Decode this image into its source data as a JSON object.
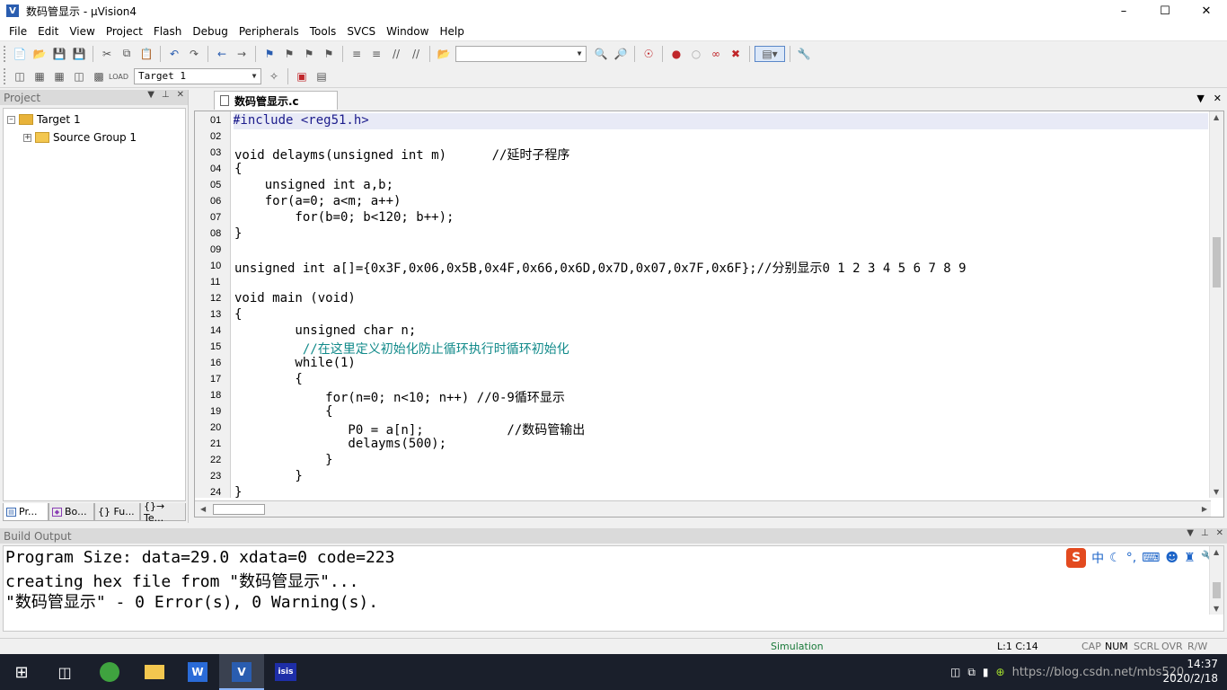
{
  "window": {
    "title": "数码管显示 - μVision4",
    "app_icon": "uvision-icon"
  },
  "menu": [
    "File",
    "Edit",
    "View",
    "Project",
    "Flash",
    "Debug",
    "Peripherals",
    "Tools",
    "SVCS",
    "Window",
    "Help"
  ],
  "toolbar": {
    "target_select": "Target 1"
  },
  "project_panel": {
    "title": "Project",
    "tree": [
      {
        "label": "Target 1"
      },
      {
        "label": "Source Group 1"
      }
    ],
    "tabs": [
      "Pr...",
      "Bo...",
      "{} Fu...",
      "{}→ Te..."
    ]
  },
  "editor": {
    "tab": "数码管显示.c",
    "lines": [
      {
        "no": "01",
        "text": "#include <reg51.h>"
      },
      {
        "no": "02",
        "text": ""
      },
      {
        "no": "03",
        "text": "void delayms(unsigned int m)      //延时子程序"
      },
      {
        "no": "04",
        "text": "{"
      },
      {
        "no": "05",
        "text": "    unsigned int a,b;"
      },
      {
        "no": "06",
        "text": "    for(a=0; a<m; a++)"
      },
      {
        "no": "07",
        "text": "        for(b=0; b<120; b++);"
      },
      {
        "no": "08",
        "text": "}"
      },
      {
        "no": "09",
        "text": ""
      },
      {
        "no": "10",
        "text": "unsigned int a[]={0x3F,0x06,0x5B,0x4F,0x66,0x6D,0x7D,0x07,0x7F,0x6F};//分别显示0 1 2 3 4 5 6 7 8 9"
      },
      {
        "no": "11",
        "text": ""
      },
      {
        "no": "12",
        "text": "void main (void)"
      },
      {
        "no": "13",
        "text": "{"
      },
      {
        "no": "14",
        "text": "        unsigned char n;"
      },
      {
        "no": "15",
        "text": "         //在这里定义初始化防止循环执行时循环初始化"
      },
      {
        "no": "16",
        "text": "        while(1)"
      },
      {
        "no": "17",
        "text": "        {"
      },
      {
        "no": "18",
        "text": "            for(n=0; n<10; n++) //0-9循环显示"
      },
      {
        "no": "19",
        "text": "            {"
      },
      {
        "no": "20",
        "text": "               P0 = a[n];           //数码管输出"
      },
      {
        "no": "21",
        "text": "               delayms(500);"
      },
      {
        "no": "22",
        "text": "            }"
      },
      {
        "no": "23",
        "text": "        }"
      },
      {
        "no": "24",
        "text": "}"
      }
    ]
  },
  "build_output": {
    "title": "Build Output",
    "lines": [
      "Program Size: data=29.0 xdata=0 code=223",
      "creating hex file from \"数码管显示\"...",
      "\"数码管显示\" - 0 Error(s), 0 Warning(s)."
    ],
    "ime": {
      "logo": "S",
      "mode": "中"
    }
  },
  "statusbar": {
    "mode": "Simulation",
    "position": "L:1 C:14",
    "indicators": [
      "CAP",
      "NUM",
      "SCRL",
      "OVR",
      "R/W"
    ]
  },
  "taskbar": {
    "time": "14:37",
    "date": "2020/2/18",
    "watermark": "https://blog.csdn.net/mbs520"
  },
  "colors": {
    "comment": "#118a8a",
    "highlight_line": "#e8eaf6",
    "status_mode": "#1a7a3a"
  }
}
